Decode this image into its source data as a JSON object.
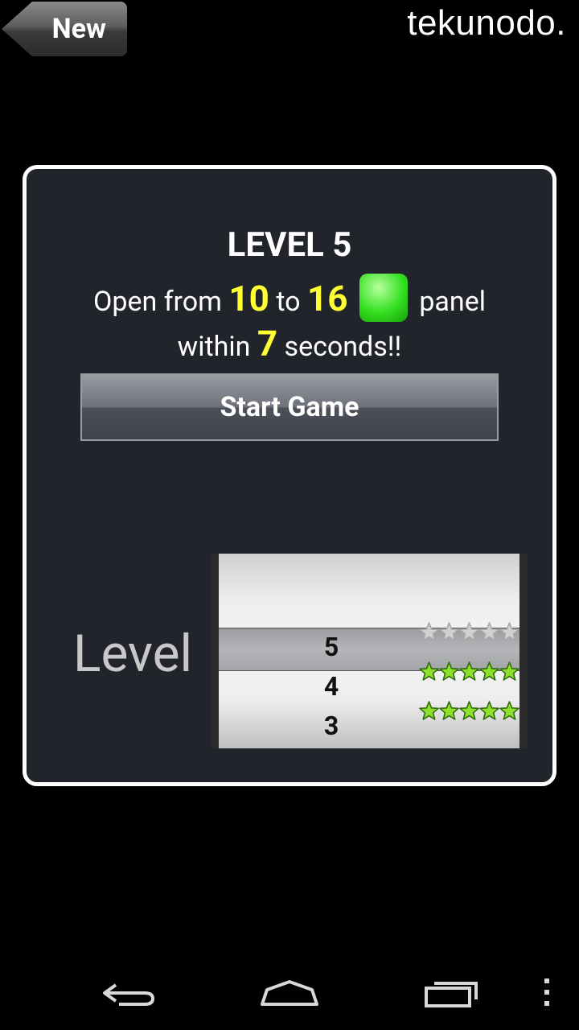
{
  "topbar": {
    "back_label": "New",
    "logo": "tekunodo."
  },
  "panel": {
    "level_title": "LEVEL 5",
    "goal": {
      "prefix": "Open from",
      "from": "10",
      "to_word": "to",
      "to": "16",
      "panel_word": "panel",
      "within": "within",
      "seconds": "7",
      "suffix": "seconds!!"
    },
    "start_button": "Start Game",
    "level_label": "Level"
  },
  "picker": {
    "selected": "5",
    "rows": [
      {
        "level": "5",
        "stars_earned": 0,
        "stars_total": 5
      },
      {
        "level": "4",
        "stars_earned": 5,
        "stars_total": 5
      },
      {
        "level": "3",
        "stars_earned": 5,
        "stars_total": 5
      }
    ]
  },
  "colors": {
    "highlight": "#ffff33",
    "panel_bg": "#21242b",
    "star_filled": "#8fe02a",
    "star_empty": "#d0d0d0"
  },
  "navbar": {
    "icons": [
      "back-icon",
      "home-icon",
      "recent-apps-icon",
      "menu-icon"
    ]
  }
}
